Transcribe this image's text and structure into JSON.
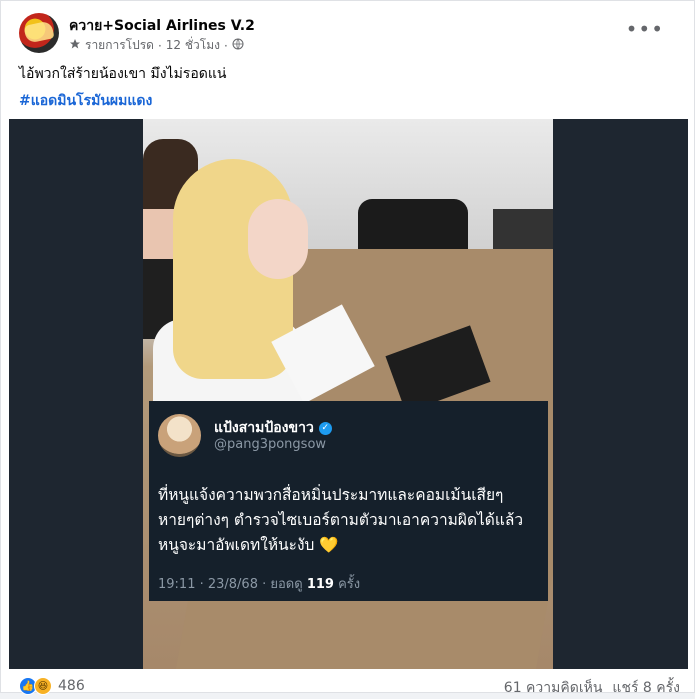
{
  "post": {
    "page_name": "ควาย+Social Airlines V.2",
    "meta_label": "รายการโปรด",
    "time": "12 ชั่วโมง",
    "separator": "·",
    "caption": "ไอ้พวกใส่ร้ายน้องเขา มึงไม่รอดแน่",
    "hashtag": "#แอดมินโรมันผมแดง"
  },
  "tweet": {
    "name": "แป้งสามป้องขาว",
    "handle": "@pang3pongsow",
    "lines": [
      "ที่หนูแจ้งความพวกสื่อหมิ่นประมาทและคอมเม้นเสียๆ",
      "หายๆต่างๆ ตำรวจไซเบอร์ตามตัวมาเอาความผิดได้แล้ว",
      "หนูจะมาอัพเดทให้นะงับ 💛"
    ],
    "stats_prefix": "19:11 · 23/8/68 · ยอดดู",
    "views": "119",
    "stats_suffix": "ครั้ง"
  },
  "footer": {
    "reaction_count": "486",
    "comments": "61 ความคิดเห็น",
    "shares": "แชร์ 8 ครั้ง"
  },
  "icons": {
    "star": "star-icon",
    "globe": "globe-icon",
    "more": "more-options-icon",
    "verified": "verified-badge-icon",
    "like": "like-reaction-icon",
    "haha": "haha-reaction-icon"
  },
  "colors": {
    "hashtag": "#1a66d6",
    "tweet_bg": "#15202b",
    "verified": "#1d9bf0",
    "like": "#1877f2"
  }
}
